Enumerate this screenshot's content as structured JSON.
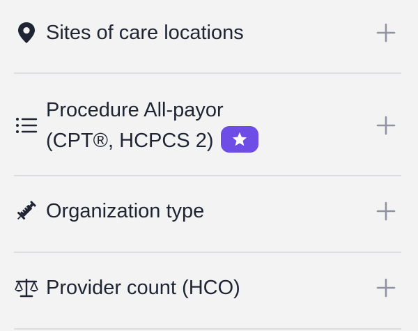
{
  "filters": [
    {
      "label": "Sites of care locations",
      "icon": "location-pin-icon",
      "action_icon": "plus-icon"
    },
    {
      "label_line1": "Procedure All-payor",
      "label_line2": "(CPT®, HCPCS 2)",
      "icon": "list-icon",
      "badge_icon": "star-icon",
      "action_icon": "plus-icon"
    },
    {
      "label": "Organization type",
      "icon": "syringe-icon",
      "action_icon": "plus-icon"
    },
    {
      "label": "Provider count (HCO)",
      "icon": "scale-icon",
      "action_icon": "plus-icon"
    }
  ],
  "colors": {
    "background": "#f3f3f4",
    "text": "#1f2433",
    "divider": "#dcdde0",
    "plus": "#8f93a0",
    "badge": "#6e4ce6"
  }
}
